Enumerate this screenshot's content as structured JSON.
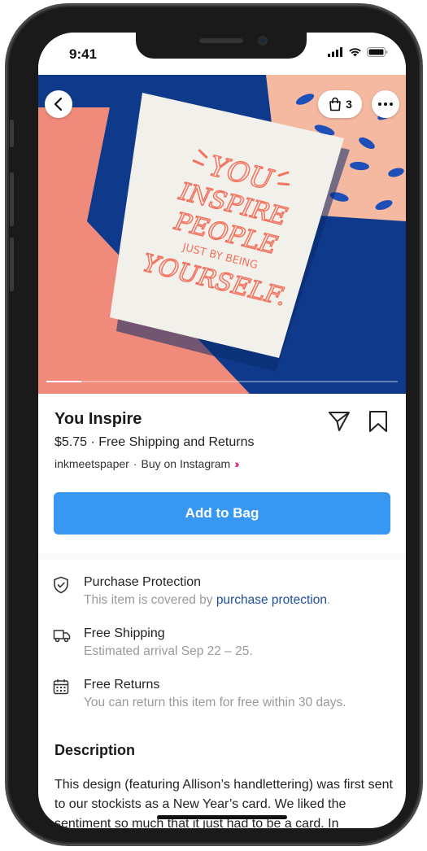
{
  "status_bar": {
    "time": "9:41",
    "icons": [
      "signal-icon",
      "wifi-icon",
      "battery-icon"
    ]
  },
  "hero": {
    "image_description_icon": "greeting-card-photo",
    "back_icon": "chevron-left-icon",
    "bag_icon": "shopping-bag-icon",
    "bag_count": "3",
    "more_icon": "more-horizontal-icon",
    "card_lines": [
      "YOU",
      "INSPIRE",
      "PEOPLE",
      "JUST BY BEING",
      "YOURSELF."
    ],
    "gallery_progress": 0.1,
    "colors": {
      "blue": "#0f3a8c",
      "coral": "#f08a7a",
      "peach": "#f5b8a0",
      "card": "#f1f0ea",
      "lettering": "#f2735f"
    }
  },
  "product": {
    "title": "You Inspire",
    "price_line": "$5.75 · Free Shipping and Returns",
    "seller": "inkmeetspaper",
    "separator": "·",
    "buy_on": "Buy on Instagram",
    "chevrons": "››"
  },
  "actions": {
    "share_icon": "send-icon",
    "save_icon": "bookmark-icon",
    "add_to_bag": "Add to Bag",
    "accent": "#3897f0"
  },
  "info": [
    {
      "icon": "shield-icon",
      "title": "Purchase Protection",
      "sub_prefix": "This item is covered by ",
      "sub_link": "purchase protection",
      "sub_suffix": "."
    },
    {
      "icon": "truck-icon",
      "title": "Free Shipping",
      "sub": "Estimated arrival Sep 22 – 25."
    },
    {
      "icon": "calendar-icon",
      "title": "Free Returns",
      "sub": "You can return this item for free within 30 days."
    }
  ],
  "description": {
    "heading": "Description",
    "body": "This design (featuring Allison’s handlettering) was first sent to our stockists as a New Year’s card. We liked the sentiment so much that it just had to be a card. In"
  }
}
